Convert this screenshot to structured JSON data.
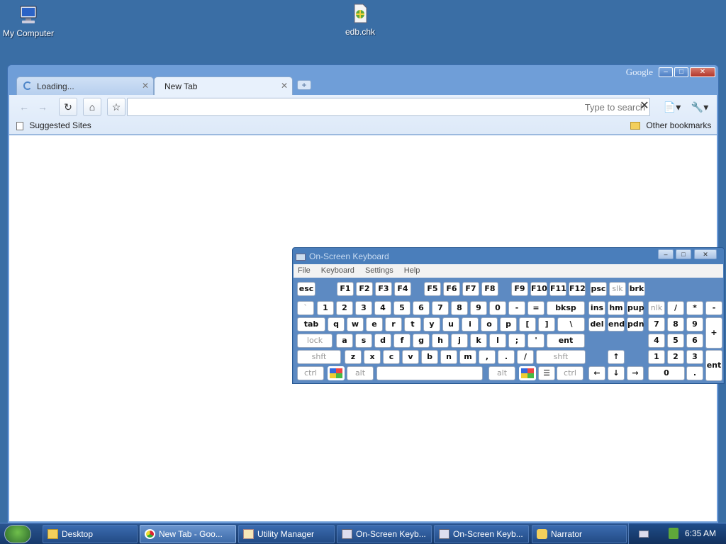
{
  "desktop": {
    "icons": [
      {
        "label": "My Computer",
        "icon": "computer-icon"
      },
      {
        "label": "edb.chk",
        "icon": "file-icon"
      }
    ]
  },
  "browser": {
    "brand": "Google",
    "tabs": [
      {
        "label": "Loading...",
        "state": "loading"
      },
      {
        "label": "New Tab",
        "state": "active"
      }
    ],
    "omnibox": {
      "value": "",
      "placeholder": "Type to search"
    },
    "bookmarks": {
      "left": "Suggested Sites",
      "right": "Other bookmarks"
    }
  },
  "osk": {
    "title": "On-Screen Keyboard",
    "menu": [
      "File",
      "Keyboard",
      "Settings",
      "Help"
    ],
    "rows": {
      "fn": [
        "esc",
        "F1",
        "F2",
        "F3",
        "F4",
        "F5",
        "F6",
        "F7",
        "F8",
        "F9",
        "F10",
        "F11",
        "F12",
        "psc",
        "slk",
        "brk"
      ],
      "num": [
        "`",
        "1",
        "2",
        "3",
        "4",
        "5",
        "6",
        "7",
        "8",
        "9",
        "0",
        "-",
        "=",
        "bksp",
        "ins",
        "hm",
        "pup",
        "nlk",
        "/",
        "*",
        "-"
      ],
      "q": [
        "tab",
        "q",
        "w",
        "e",
        "r",
        "t",
        "y",
        "u",
        "i",
        "o",
        "p",
        "[",
        "]",
        "\\",
        "del",
        "end",
        "pdn",
        "7",
        "8",
        "9",
        "+"
      ],
      "a": [
        "lock",
        "a",
        "s",
        "d",
        "f",
        "g",
        "h",
        "j",
        "k",
        "l",
        ";",
        "'",
        "ent",
        "4",
        "5",
        "6"
      ],
      "z": [
        "shft",
        "z",
        "x",
        "c",
        "v",
        "b",
        "n",
        "m",
        ",",
        ".",
        "/",
        "shft",
        "↑",
        "1",
        "2",
        "3",
        "ent"
      ],
      "bottom": [
        "ctrl",
        "alt",
        "alt",
        "ctrl",
        "←",
        "↓",
        "→",
        "0",
        "."
      ]
    }
  },
  "taskbar": {
    "items": [
      {
        "label": "Desktop",
        "icon": "folder-icon"
      },
      {
        "label": "New Tab - Goo...",
        "icon": "chrome-icon",
        "active": true
      },
      {
        "label": "Utility Manager",
        "icon": "utility-manager-icon"
      },
      {
        "label": "On-Screen Keyb...",
        "icon": "keyboard-icon"
      },
      {
        "label": "On-Screen Keyb...",
        "icon": "keyboard-icon"
      },
      {
        "label": "Narrator",
        "icon": "narrator-icon"
      }
    ],
    "clock": "6:35 AM"
  }
}
